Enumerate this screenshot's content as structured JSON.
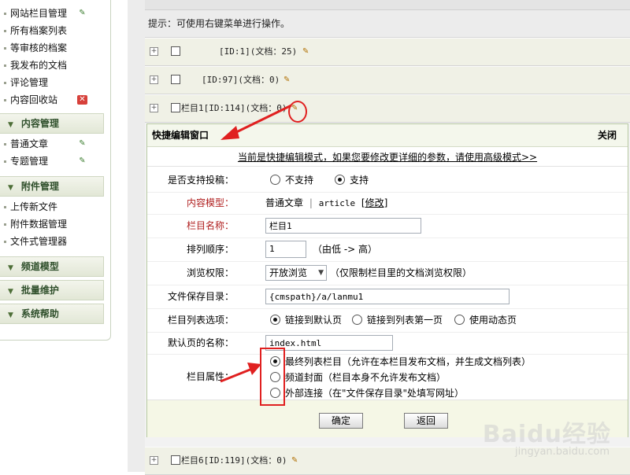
{
  "sidebar": {
    "items_top": [
      {
        "label": "网站栏目管理",
        "icon": "edit-icon"
      },
      {
        "label": "所有档案列表",
        "icon": ""
      },
      {
        "label": "等审核的档案",
        "icon": ""
      },
      {
        "label": "我发布的文档",
        "icon": ""
      },
      {
        "label": "评论管理",
        "icon": ""
      },
      {
        "label": "内容回收站",
        "icon": "recycle-icon"
      }
    ],
    "section_content": "内容管理",
    "items_content": [
      {
        "label": "普通文章",
        "icon": "edit-icon"
      },
      {
        "label": "专题管理",
        "icon": "edit-icon"
      }
    ],
    "section_attach": "附件管理",
    "items_attach": [
      {
        "label": "上传新文件"
      },
      {
        "label": "附件数据管理"
      },
      {
        "label": "文件式管理器"
      }
    ],
    "section_channel": "频道模型",
    "section_batch": "批量维护",
    "section_help": "系统帮助"
  },
  "main": {
    "hint": "提示：可使用右键菜单进行操作。",
    "expand_symbol": "+",
    "rows": [
      {
        "label": "[ID:1](文档：25)"
      },
      {
        "label": "[ID:97](文档：0)"
      },
      {
        "label": "栏目1[ID:114](文档：0)"
      }
    ],
    "row_bottom": {
      "label": "栏目6[ID:119](文档：0)"
    }
  },
  "panel": {
    "title": "快捷编辑窗口",
    "close": "关闭",
    "mode_link": "当前是快捷编辑模式，如果您要修改更详细的参数，请使用高级模式>>",
    "fields": {
      "allow_submit": {
        "label": "是否支持投稿：",
        "opt_no": "不支持",
        "opt_yes": "支持"
      },
      "content_model": {
        "label": "内容模型：",
        "value": "普通文章",
        "sep": "|",
        "code": "article",
        "edit_link": "[修改]"
      },
      "name": {
        "label": "栏目名称：",
        "value": "栏目1"
      },
      "order": {
        "label": "排列顺序：",
        "value": "1",
        "note": "（由低 -> 高）"
      },
      "browse": {
        "label": "浏览权限：",
        "selected": "开放浏览",
        "note": "（仅限制栏目里的文档浏览权限）"
      },
      "save_dir": {
        "label": "文件保存目录：",
        "value": "{cmspath}/a/lanmu1"
      },
      "list_option": {
        "label": "栏目列表选项：",
        "opt1": "链接到默认页",
        "opt2": "链接到列表第一页",
        "opt3": "使用动态页"
      },
      "default_page": {
        "label": "默认页的名称：",
        "value": "index.html"
      },
      "attr": {
        "label": "栏目属性：",
        "opt1": "最终列表栏目（允许在本栏目发布文档，并生成文档列表）",
        "opt2": "频道封面（栏目本身不允许发布文档）",
        "opt3": "外部连接（在\"文件保存目录\"处填写网址）"
      }
    },
    "ok": "确定",
    "back": "返回"
  },
  "watermark": {
    "brand": "Baidu经验",
    "url": "jingyan.baidu.com"
  },
  "colors": {
    "accent_red": "#e02020",
    "section_text": "#2f4f2b",
    "required_label": "#b02020"
  }
}
